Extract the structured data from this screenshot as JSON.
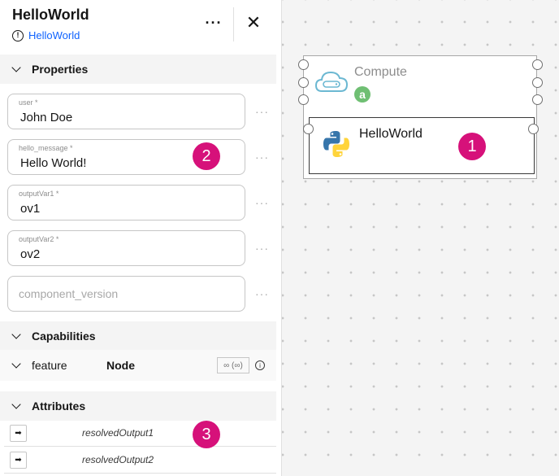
{
  "panel": {
    "title": "HelloWorld",
    "subtitle_link": "HelloWorld",
    "info_glyph": "!",
    "more_glyph": "···",
    "close_glyph": "✕"
  },
  "sections": {
    "properties": "Properties",
    "capabilities": "Capabilities",
    "attributes": "Attributes"
  },
  "properties": [
    {
      "label": "user *",
      "value": "John Doe"
    },
    {
      "label": "hello_message *",
      "value": "Hello World!"
    },
    {
      "label": "outputVar1 *",
      "value": "ov1"
    },
    {
      "label": "outputVar2 *",
      "value": "ov2"
    },
    {
      "label": "",
      "value": "",
      "placeholder": "component_version"
    }
  ],
  "field_more_glyph": "···",
  "capability": {
    "name": "feature",
    "type": "Node",
    "occurrences": "∞ (∞)",
    "info_glyph": "i"
  },
  "attributes": [
    {
      "name": "resolvedOutput1",
      "icon": "output-arrow-icon",
      "glyph": "➡"
    },
    {
      "name": "resolvedOutput2",
      "icon": "output-arrow-icon",
      "glyph": "➡"
    }
  ],
  "annotations": [
    "1",
    "2",
    "3"
  ],
  "canvas": {
    "compute_label": "Compute",
    "compute_badge": "a",
    "node_label": "HelloWorld"
  },
  "colors": {
    "accent": "#0f62fe",
    "annotation_badge": "#d6117a",
    "compute_badge": "#6fbf73",
    "cloud_icon": "#6cb8d2",
    "python_blue": "#3776ab",
    "python_yellow": "#ffd43b"
  }
}
